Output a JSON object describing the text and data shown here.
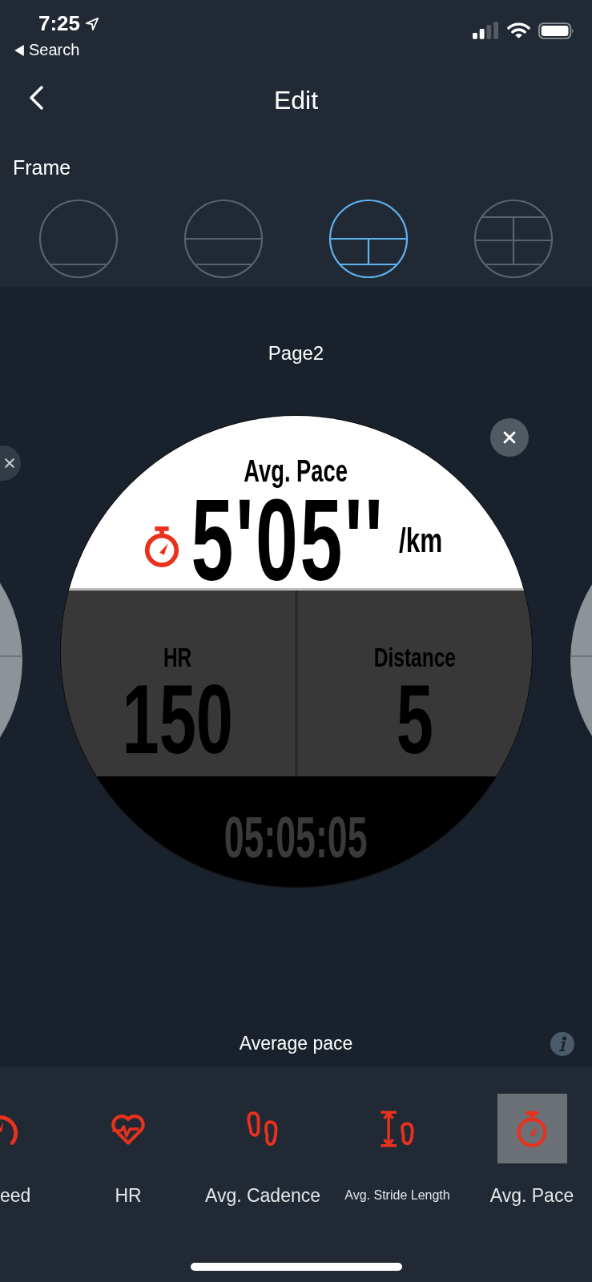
{
  "status_bar": {
    "time": "7:25",
    "back_label": "Search"
  },
  "nav": {
    "title": "Edit"
  },
  "frame": {
    "label": "Frame",
    "options": [
      {
        "kind": "bottom",
        "selected": false
      },
      {
        "kind": "rows",
        "selected": false
      },
      {
        "kind": "split",
        "selected": true
      },
      {
        "kind": "quad",
        "selected": false
      }
    ]
  },
  "page": {
    "title": "Page2"
  },
  "watch": {
    "top": {
      "label": "Avg. Pace",
      "value": "5'05''",
      "unit": "/km"
    },
    "left": {
      "label": "HR",
      "value": "150"
    },
    "right": {
      "label": "Distance",
      "value": "5"
    },
    "bottom": {
      "value": "05:05:05"
    }
  },
  "field_description": "Average pace",
  "fields": [
    {
      "kind": "speed",
      "label": "eed",
      "selected": false,
      "clipped": true
    },
    {
      "kind": "heart",
      "label": "HR",
      "selected": false
    },
    {
      "kind": "cadence",
      "label": "Avg. Cadence",
      "selected": false
    },
    {
      "kind": "stride",
      "label": "Avg. Stride Length",
      "selected": false
    },
    {
      "kind": "pace",
      "label": "Avg. Pace",
      "selected": true
    }
  ]
}
